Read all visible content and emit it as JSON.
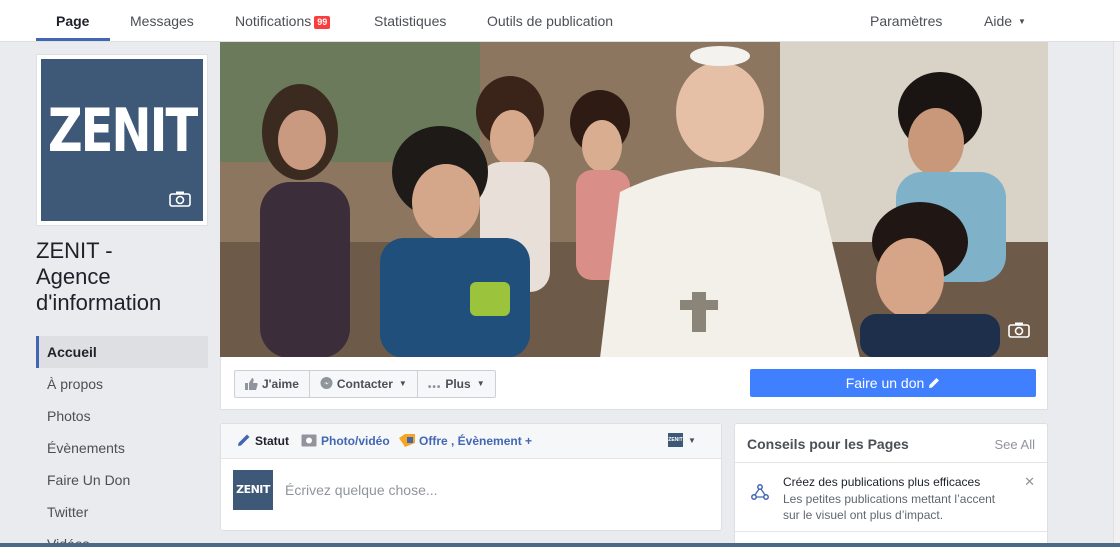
{
  "topnav": {
    "tabs": [
      "Page",
      "Messages",
      "Notifications",
      "Statistiques",
      "Outils de publication"
    ],
    "notif_count": "99",
    "right": [
      "Paramètres",
      "Aide"
    ]
  },
  "profile": {
    "logo": "ZENIT",
    "name_lines": [
      "ZENIT -",
      "Agence",
      "d'information"
    ]
  },
  "sidebar": {
    "items": [
      {
        "label": "Accueil"
      },
      {
        "label": "À propos"
      },
      {
        "label": "Photos"
      },
      {
        "label": "Évènements"
      },
      {
        "label": "Faire Un Don"
      },
      {
        "label": "Twitter"
      },
      {
        "label": "Vidéos"
      }
    ]
  },
  "actions": {
    "like": "J'aime",
    "contact": "Contacter",
    "more": "Plus",
    "donate": "Faire un don"
  },
  "composer": {
    "tab_status": "Statut",
    "tab_photo": "Photo/vidéo",
    "tab_offer": "Offre , Évènement +",
    "avatar_logo": "ZENIT",
    "mini_logo": "ZENIT",
    "placeholder": "Écrivez quelque chose..."
  },
  "tips": {
    "title": "Conseils pour les Pages",
    "see_all": "See All",
    "item_title": "Créez des publications plus efficaces",
    "item_desc": "Les petites publications mettant l’accent sur le visuel ont plus d’impact."
  },
  "colors": {
    "brand_blue": "#4267b2",
    "donate_blue": "#4080ff",
    "logo_bg": "#3e5878",
    "badge_red": "#fa3e3e"
  }
}
